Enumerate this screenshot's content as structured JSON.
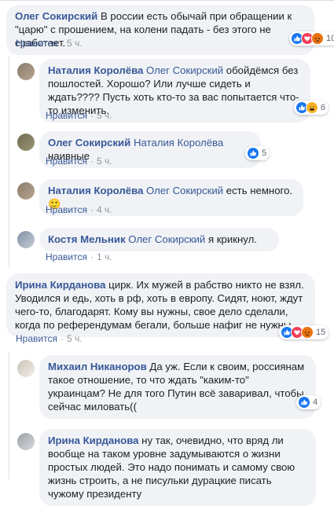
{
  "like_label": "Нравится",
  "dot": "·",
  "comments": [
    {
      "author": "Олег Сокирский",
      "mention": "",
      "text": "В россии есть обычай при обращении к \"царю\" с прошением, на колени падать - без этого не сработает.",
      "time": "5 ч.",
      "reactions": {
        "icons": [
          "like-icon",
          "love-icon",
          "angry-icon"
        ],
        "count": "10"
      }
    },
    {
      "author": "Наталия Королёва",
      "mention": "Олег Сокирский",
      "text": "обойдёмся без пошлостей. Хорошо? Или лучше сидеть и ждать???? Пусть хоть кто-то за вас попытается что-то изменить.",
      "time": "5 ч.",
      "reactions": {
        "icons": [
          "like-icon",
          "haha-icon"
        ],
        "count": "6"
      }
    },
    {
      "author": "Олег Сокирский",
      "mention": "Наталия Королёва",
      "text": "наивные",
      "time": "5 ч.",
      "reactions": {
        "icons": [
          "like-icon"
        ],
        "count": "5"
      }
    },
    {
      "author": "Наталия Королёва",
      "mention": "Олег Сокирский",
      "text": "есть немного. 🙂",
      "time": "4 ч.",
      "reactions": null
    },
    {
      "author": "Костя Мельник",
      "mention": "Олег Сокирский",
      "text": "я крикнул.",
      "time": "1 ч.",
      "reactions": null
    },
    {
      "author": "Ирина Кирданова",
      "mention": "",
      "text": "цирк. Их мужей в рабство никто не взял. Уводился и едь, хоть в рф, хоть в европу. Сидят, ноют, ждут чего-то, благодарят. Кому вы нужны, свое дело сделали, когда по референдумам бегали, больше нафиг не нужны",
      "time": "5 ч.",
      "reactions": {
        "icons": [
          "like-icon",
          "love-icon",
          "angry-icon"
        ],
        "count": "15"
      }
    },
    {
      "author": "Михаил Никаноров",
      "mention": "",
      "text": "Да уж. Если к своим, россиянам такое отношение, то что ждать \"каким-то\" украинцам? Не для того Путин всё заваривал, чтобы сейчас миловать((",
      "time": "",
      "reactions": {
        "icons": [
          "like-icon"
        ],
        "count": "4"
      }
    },
    {
      "author": "Ирина Кирданова",
      "mention": "",
      "text": "ну так, очевидно, что вряд ли вообще на таком уровне задумываются о жизни простых людей. Это надо понимать и самому свою жизнь строить, а не писульки дурацкие писать чужому президенту",
      "time": "",
      "reactions": null
    }
  ]
}
